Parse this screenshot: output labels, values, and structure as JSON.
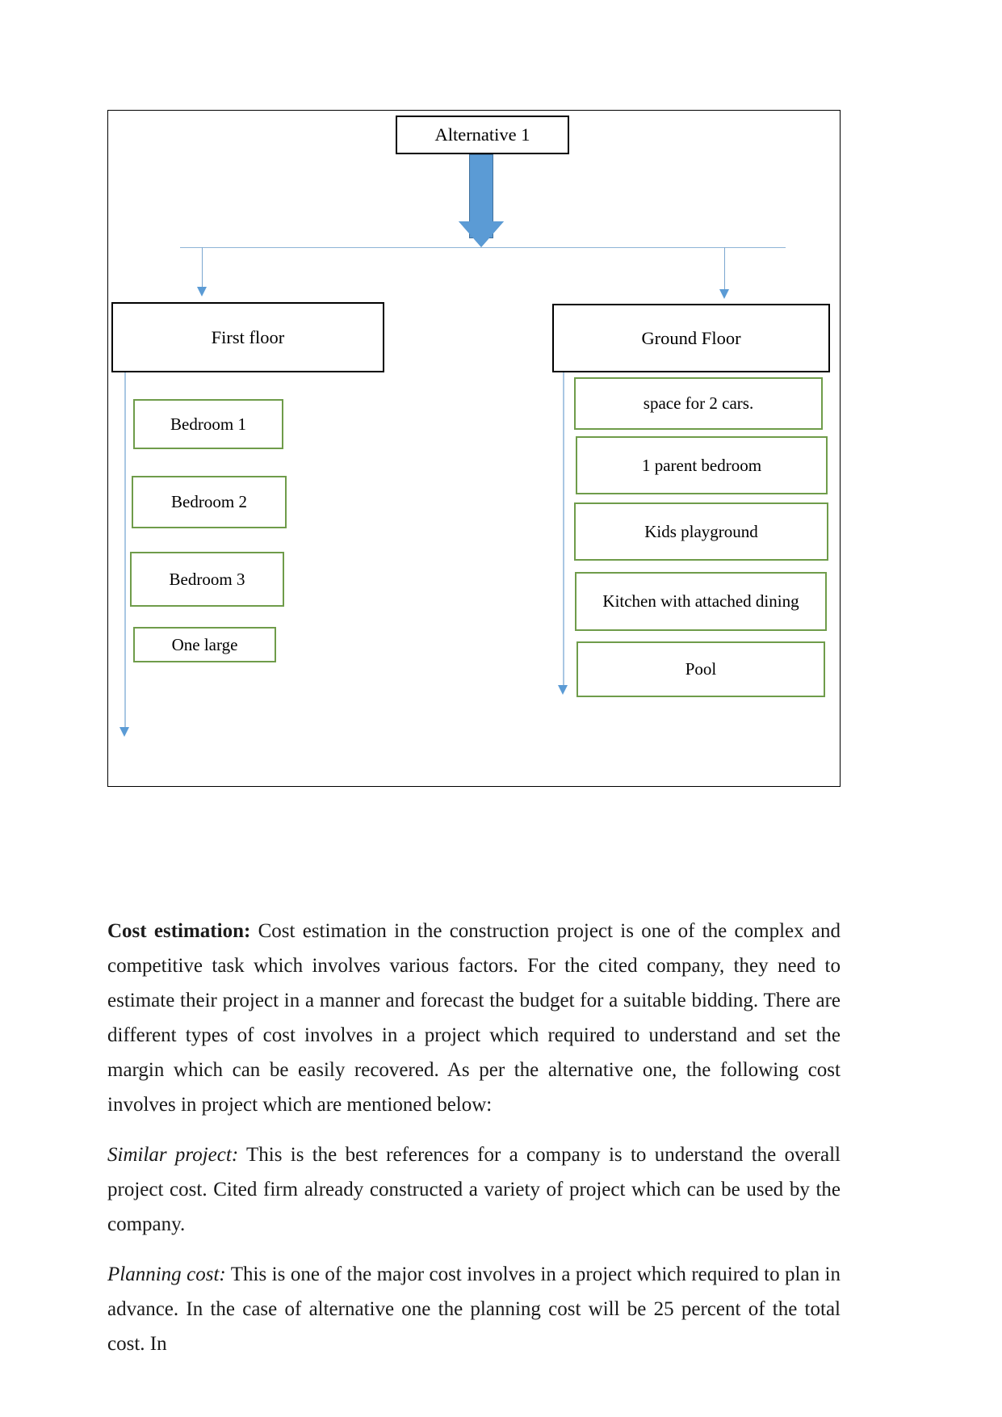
{
  "diagram": {
    "root": {
      "label": "Alternative 1"
    },
    "branches": [
      {
        "title": "First floor",
        "items": [
          {
            "label": "Bedroom 1"
          },
          {
            "label": "Bedroom 2"
          },
          {
            "label": "Bedroom 3"
          },
          {
            "label": "One large"
          }
        ]
      },
      {
        "title": "Ground Floor",
        "items": [
          {
            "label": "space for 2 cars."
          },
          {
            "label": "1 parent bedroom"
          },
          {
            "label": "Kids playground"
          },
          {
            "label": "Kitchen with attached dining"
          },
          {
            "label": "Pool"
          }
        ]
      }
    ],
    "colors": {
      "node_border": "#000000",
      "leaf_border": "#6f9c4a",
      "connector": "#7ba7d0",
      "big_arrow": "#5b9bd5",
      "big_arrow_outline": "#41719c"
    }
  },
  "body": {
    "paragraphs": [
      {
        "lead": "Cost estimation:",
        "lead_style": "bold",
        "text": " Cost estimation in the construction project is one of the complex and competitive task which involves various factors. For the cited company, they need to estimate their project in a manner and forecast the budget for a suitable bidding. There are different types of cost involves in a project which required to understand and set the margin which can be easily recovered. As per the alternative one, the following cost involves in project which are mentioned below:"
      },
      {
        "lead": "Similar project:",
        "lead_style": "italic",
        "text": " This is the best references for a company is to understand the overall project cost. Cited firm already constructed a variety of project which can be used by the company."
      },
      {
        "lead": "Planning cost:",
        "lead_style": "italic",
        "text": " This is one of the major cost involves in a project which required to plan in advance. In the case of alternative one the planning cost will be 25 percent of the total cost. In"
      }
    ]
  }
}
